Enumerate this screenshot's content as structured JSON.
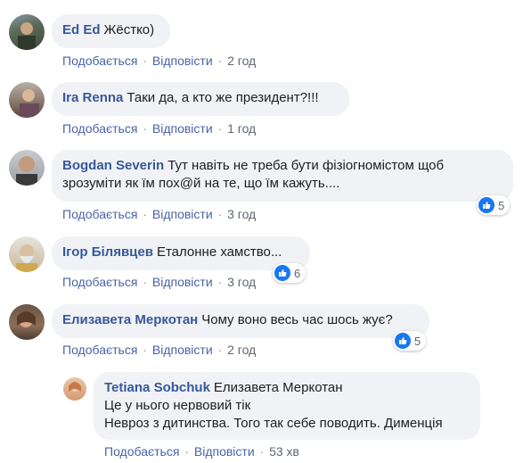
{
  "actions": {
    "like": "Подобається",
    "reply": "Відповісти",
    "separator": "·"
  },
  "comments": [
    {
      "author": "Ed Ed",
      "text": "Жёстко)",
      "time": "2 год",
      "reactions": null
    },
    {
      "author": "Ira Renna",
      "text": "Таки да, а кто же президент?!!!",
      "time": "1 год",
      "reactions": null
    },
    {
      "author": "Bogdan Severin",
      "text_line1": "Тут навіть не треба бути фізіогномістом щоб",
      "text_line2": "зрозуміти як їм пох@й на те, що їм кажуть....",
      "time": "3 год",
      "reactions": "5"
    },
    {
      "author": "Ігор Білявцев",
      "text": "Еталонне хамство...",
      "time": "3 год",
      "reactions": "6"
    },
    {
      "author": "Елизавета Меркотан",
      "text": "Чому воно весь час шось жує?",
      "time": "2 год",
      "reactions": "5"
    }
  ],
  "reply": {
    "author": "Tetiana Sobchuk",
    "mention": "Елизавета Меркотан",
    "line2": "Це у нього нервовий тік",
    "line3": "Невроз з дитинства. Того так себе поводить. Дименція",
    "time": "53 хв"
  },
  "colors": {
    "name": "#385898",
    "bubble": "#f0f2f5",
    "link": "#4a62a8",
    "like": "#1877f2"
  }
}
